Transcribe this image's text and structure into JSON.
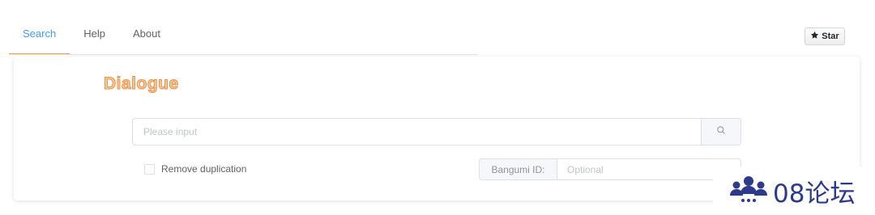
{
  "tabs": [
    {
      "label": "Search",
      "active": true
    },
    {
      "label": "Help",
      "active": false
    },
    {
      "label": "About",
      "active": false
    }
  ],
  "star_button": {
    "label": "Star",
    "icon": "star-icon"
  },
  "card": {
    "title": "Dialogue",
    "search": {
      "placeholder": "Please input",
      "value": "",
      "icon": "search-icon"
    },
    "remove_duplication": {
      "label": "Remove duplication",
      "checked": false
    },
    "bangumi": {
      "label": "Bangumi ID:",
      "placeholder": "Optional",
      "value": ""
    }
  },
  "watermark": {
    "text": "08论坛",
    "icon": "people-group-icon"
  },
  "colors": {
    "accent": "#409eff",
    "tab_underline": "#f0a04b",
    "title_fill": "#f5c89a",
    "title_stroke": "#e8944a",
    "watermark": "#2d3a8c"
  }
}
